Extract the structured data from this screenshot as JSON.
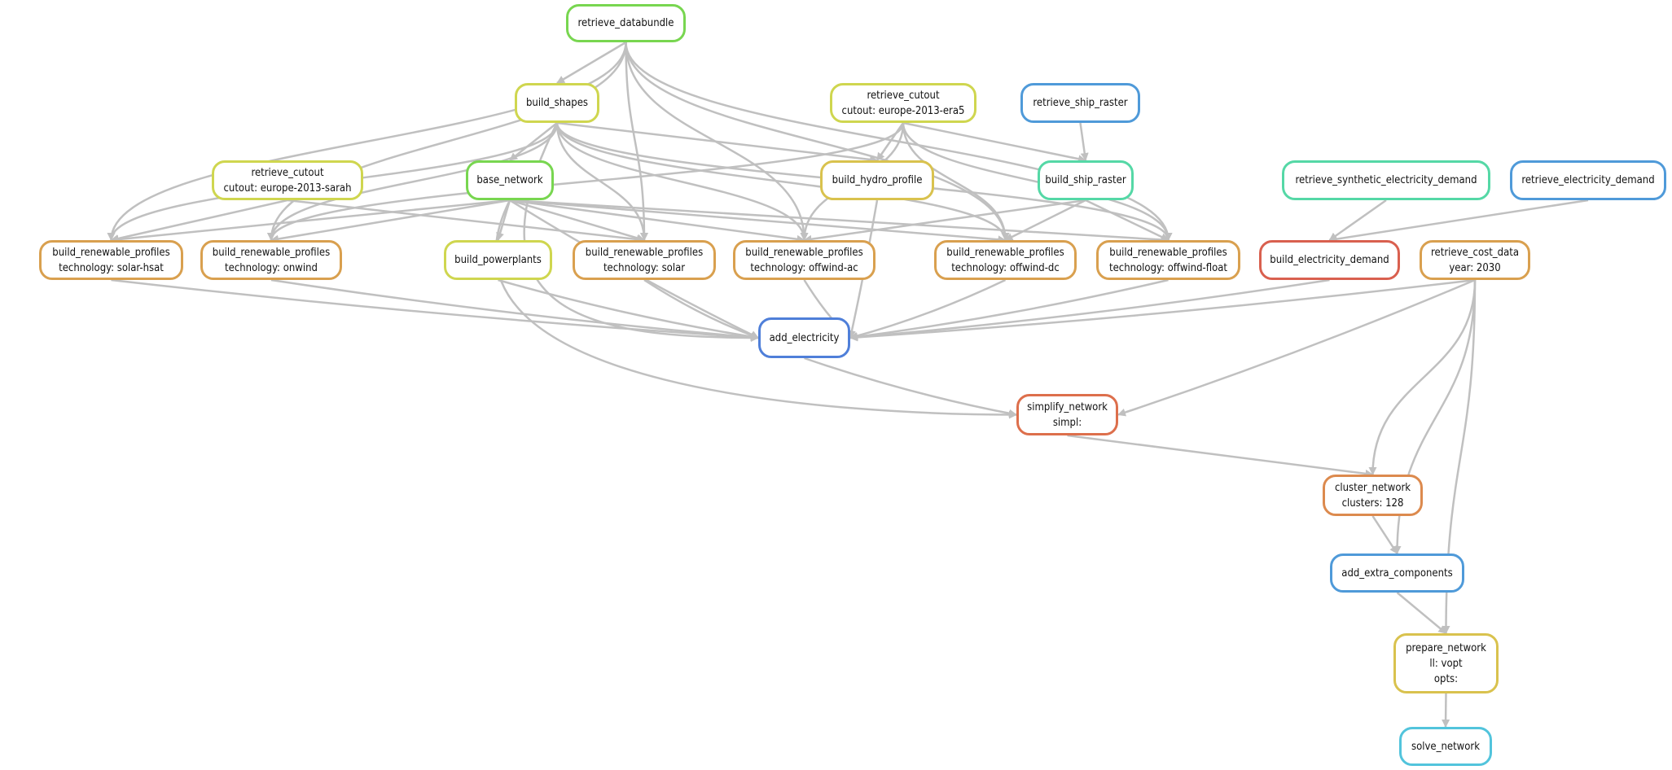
{
  "colors": {
    "green": "#78d650",
    "lime": "#cfd64f",
    "yellow": "#d9c24e",
    "orange": "#d9a04f",
    "orange2": "#dc8a4e",
    "red": "#d9604f",
    "redorange": "#dd6f4c",
    "blue": "#4f7fd9",
    "skyblue": "#4f9ad9",
    "teal": "#55d8a6",
    "cyan": "#52c4dc",
    "edge": "#c0c0c0"
  },
  "nodes": [
    {
      "id": "retrieve_databundle",
      "lines": [
        "retrieve_databundle"
      ],
      "color": "green"
    },
    {
      "id": "build_shapes",
      "lines": [
        "build_shapes"
      ],
      "color": "lime"
    },
    {
      "id": "retrieve_cutout_era5",
      "lines": [
        "retrieve_cutout",
        "cutout: europe-2013-era5"
      ],
      "color": "lime"
    },
    {
      "id": "retrieve_ship_raster",
      "lines": [
        "retrieve_ship_raster"
      ],
      "color": "skyblue"
    },
    {
      "id": "retrieve_cutout_sarah",
      "lines": [
        "retrieve_cutout",
        "cutout: europe-2013-sarah"
      ],
      "color": "lime"
    },
    {
      "id": "base_network",
      "lines": [
        "base_network"
      ],
      "color": "green"
    },
    {
      "id": "build_hydro_profile",
      "lines": [
        "build_hydro_profile"
      ],
      "color": "yellow"
    },
    {
      "id": "build_ship_raster",
      "lines": [
        "build_ship_raster"
      ],
      "color": "teal"
    },
    {
      "id": "retrieve_synthetic_electricity_demand",
      "lines": [
        "retrieve_synthetic_electricity_demand"
      ],
      "color": "teal"
    },
    {
      "id": "retrieve_electricity_demand",
      "lines": [
        "retrieve_electricity_demand"
      ],
      "color": "skyblue"
    },
    {
      "id": "brp_solar_hsat",
      "lines": [
        "build_renewable_profiles",
        "technology: solar-hsat"
      ],
      "color": "orange"
    },
    {
      "id": "brp_onwind",
      "lines": [
        "build_renewable_profiles",
        "technology: onwind"
      ],
      "color": "orange"
    },
    {
      "id": "build_powerplants",
      "lines": [
        "build_powerplants"
      ],
      "color": "lime"
    },
    {
      "id": "brp_solar",
      "lines": [
        "build_renewable_profiles",
        "technology: solar"
      ],
      "color": "orange"
    },
    {
      "id": "brp_offwind_ac",
      "lines": [
        "build_renewable_profiles",
        "technology: offwind-ac"
      ],
      "color": "orange"
    },
    {
      "id": "brp_offwind_dc",
      "lines": [
        "build_renewable_profiles",
        "technology: offwind-dc"
      ],
      "color": "orange"
    },
    {
      "id": "brp_offwind_float",
      "lines": [
        "build_renewable_profiles",
        "technology: offwind-float"
      ],
      "color": "orange"
    },
    {
      "id": "build_electricity_demand",
      "lines": [
        "build_electricity_demand"
      ],
      "color": "red"
    },
    {
      "id": "retrieve_cost_data",
      "lines": [
        "retrieve_cost_data",
        "year: 2030"
      ],
      "color": "orange"
    },
    {
      "id": "add_electricity",
      "lines": [
        "add_electricity"
      ],
      "color": "blue"
    },
    {
      "id": "simplify_network",
      "lines": [
        "simplify_network",
        "simpl:"
      ],
      "color": "redorange"
    },
    {
      "id": "cluster_network",
      "lines": [
        "cluster_network",
        "clusters: 128"
      ],
      "color": "orange2"
    },
    {
      "id": "add_extra_components",
      "lines": [
        "add_extra_components"
      ],
      "color": "skyblue"
    },
    {
      "id": "prepare_network",
      "lines": [
        "prepare_network",
        "ll: vopt",
        "opts:"
      ],
      "color": "yellow"
    },
    {
      "id": "solve_network",
      "lines": [
        "solve_network"
      ],
      "color": "cyan"
    }
  ],
  "edges": [
    [
      "retrieve_databundle",
      "build_shapes"
    ],
    [
      "retrieve_databundle",
      "brp_solar_hsat"
    ],
    [
      "retrieve_databundle",
      "brp_onwind"
    ],
    [
      "retrieve_databundle",
      "brp_solar"
    ],
    [
      "retrieve_databundle",
      "brp_offwind_ac"
    ],
    [
      "retrieve_databundle",
      "brp_offwind_dc"
    ],
    [
      "retrieve_databundle",
      "brp_offwind_float"
    ],
    [
      "build_shapes",
      "base_network"
    ],
    [
      "build_shapes",
      "brp_solar_hsat"
    ],
    [
      "build_shapes",
      "brp_onwind"
    ],
    [
      "build_shapes",
      "brp_solar"
    ],
    [
      "build_shapes",
      "brp_offwind_ac"
    ],
    [
      "build_shapes",
      "brp_offwind_dc"
    ],
    [
      "build_shapes",
      "brp_offwind_float"
    ],
    [
      "build_shapes",
      "build_hydro_profile"
    ],
    [
      "build_shapes",
      "add_electricity"
    ],
    [
      "retrieve_cutout_era5",
      "build_hydro_profile"
    ],
    [
      "retrieve_cutout_era5",
      "build_ship_raster"
    ],
    [
      "retrieve_cutout_era5",
      "brp_onwind"
    ],
    [
      "retrieve_cutout_era5",
      "brp_offwind_ac"
    ],
    [
      "retrieve_cutout_era5",
      "brp_offwind_dc"
    ],
    [
      "retrieve_cutout_era5",
      "brp_offwind_float"
    ],
    [
      "retrieve_ship_raster",
      "build_ship_raster"
    ],
    [
      "build_ship_raster",
      "brp_offwind_ac"
    ],
    [
      "build_ship_raster",
      "brp_offwind_dc"
    ],
    [
      "build_ship_raster",
      "brp_offwind_float"
    ],
    [
      "retrieve_cutout_sarah",
      "brp_solar_hsat"
    ],
    [
      "retrieve_cutout_sarah",
      "brp_solar"
    ],
    [
      "base_network",
      "brp_solar_hsat"
    ],
    [
      "base_network",
      "brp_onwind"
    ],
    [
      "base_network",
      "build_powerplants"
    ],
    [
      "base_network",
      "brp_solar"
    ],
    [
      "base_network",
      "brp_offwind_ac"
    ],
    [
      "base_network",
      "brp_offwind_dc"
    ],
    [
      "base_network",
      "brp_offwind_float"
    ],
    [
      "base_network",
      "add_electricity"
    ],
    [
      "base_network",
      "simplify_network"
    ],
    [
      "build_hydro_profile",
      "add_electricity"
    ],
    [
      "brp_solar_hsat",
      "add_electricity"
    ],
    [
      "brp_onwind",
      "add_electricity"
    ],
    [
      "build_powerplants",
      "add_electricity"
    ],
    [
      "brp_solar",
      "add_electricity"
    ],
    [
      "brp_offwind_ac",
      "add_electricity"
    ],
    [
      "brp_offwind_dc",
      "add_electricity"
    ],
    [
      "brp_offwind_float",
      "add_electricity"
    ],
    [
      "build_electricity_demand",
      "add_electricity"
    ],
    [
      "retrieve_cost_data",
      "add_electricity"
    ],
    [
      "retrieve_synthetic_electricity_demand",
      "build_electricity_demand"
    ],
    [
      "retrieve_electricity_demand",
      "build_electricity_demand"
    ],
    [
      "add_electricity",
      "simplify_network"
    ],
    [
      "retrieve_cost_data",
      "simplify_network"
    ],
    [
      "simplify_network",
      "cluster_network"
    ],
    [
      "retrieve_cost_data",
      "cluster_network"
    ],
    [
      "cluster_network",
      "add_extra_components"
    ],
    [
      "retrieve_cost_data",
      "add_extra_components"
    ],
    [
      "add_extra_components",
      "prepare_network"
    ],
    [
      "retrieve_cost_data",
      "prepare_network"
    ],
    [
      "prepare_network",
      "solve_network"
    ]
  ]
}
